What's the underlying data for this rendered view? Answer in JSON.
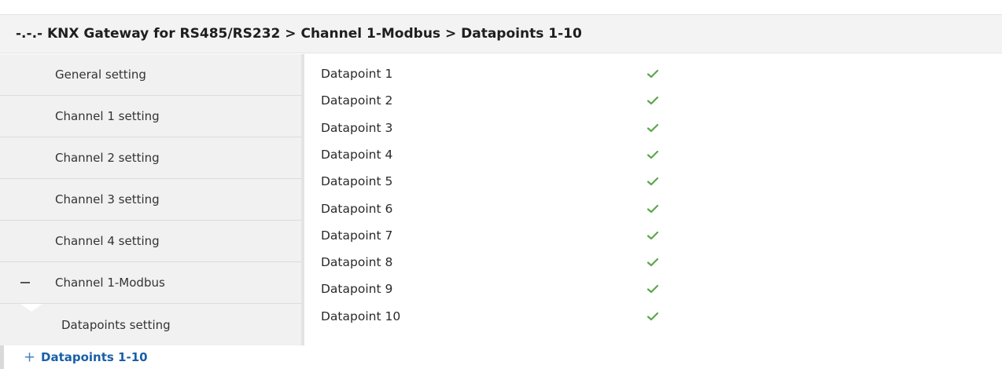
{
  "header": {
    "title": "-.-.- KNX Gateway for RS485/RS232 > Channel 1-Modbus > Datapoints 1-10"
  },
  "sidebar": {
    "items": [
      {
        "label": "General setting"
      },
      {
        "label": "Channel 1 setting"
      },
      {
        "label": "Channel 2 setting"
      },
      {
        "label": "Channel 3 setting"
      },
      {
        "label": "Channel 4 setting"
      },
      {
        "label": "Channel 1-Modbus",
        "expanded": true
      }
    ],
    "sub_item": {
      "label": "Datapoints setting"
    },
    "tree_leaf": {
      "label": "Datapoints 1-10",
      "icon": "plus-icon"
    }
  },
  "datapoints": [
    {
      "label": "Datapoint 1",
      "checked": true
    },
    {
      "label": "Datapoint 2",
      "checked": true
    },
    {
      "label": "Datapoint 3",
      "checked": true
    },
    {
      "label": "Datapoint 4",
      "checked": true
    },
    {
      "label": "Datapoint 5",
      "checked": true
    },
    {
      "label": "Datapoint 6",
      "checked": true
    },
    {
      "label": "Datapoint 7",
      "checked": true
    },
    {
      "label": "Datapoint 8",
      "checked": true
    },
    {
      "label": "Datapoint 9",
      "checked": true
    },
    {
      "label": "Datapoint 10",
      "checked": true
    }
  ],
  "colors": {
    "check_green": "#5aa84a",
    "link_blue": "#1a5fa8"
  }
}
